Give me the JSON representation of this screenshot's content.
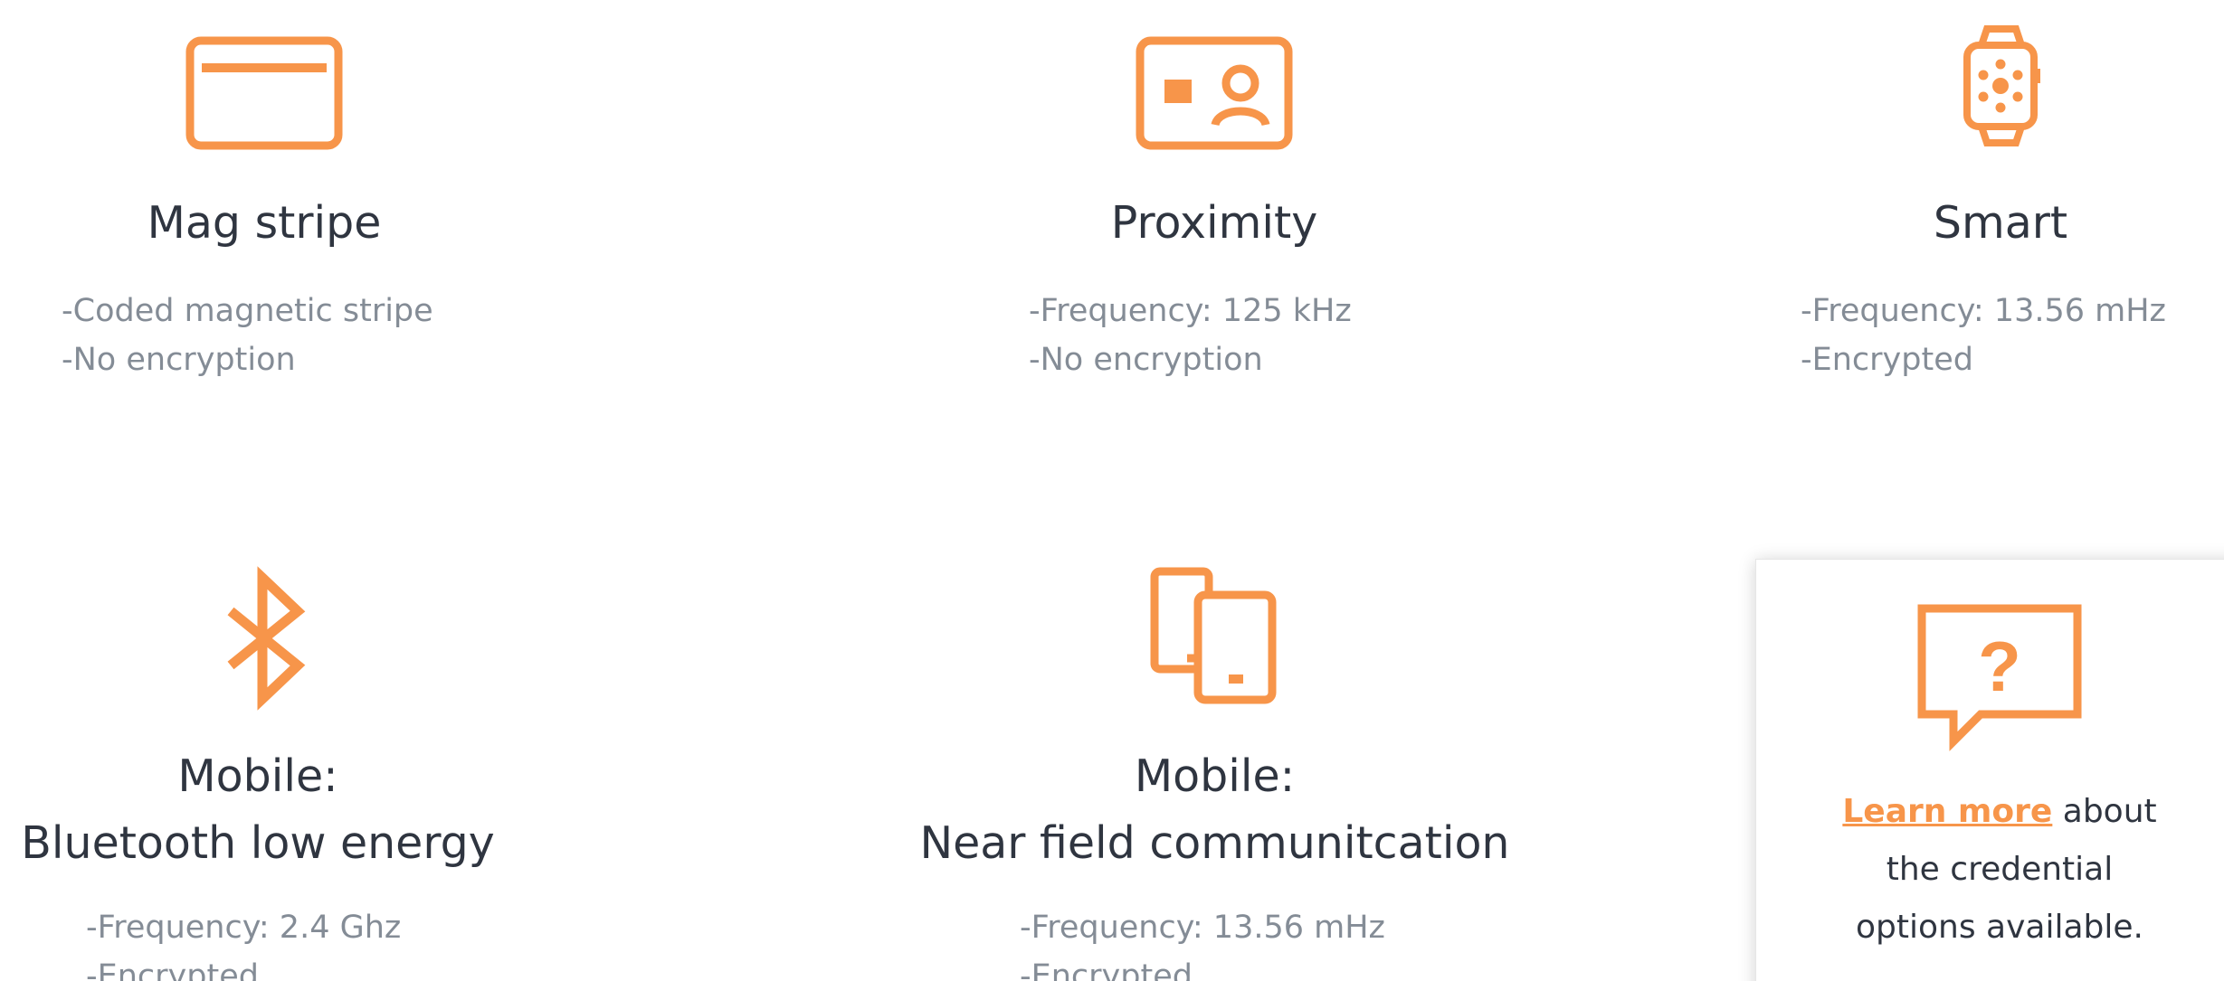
{
  "colors": {
    "accent": "#f7954a",
    "title": "#2f3540",
    "detail": "#848c96",
    "background": "#ffffff"
  },
  "credentials": [
    {
      "icon": "card-icon",
      "title_lines": [
        "Mag stripe"
      ],
      "details": [
        "-Coded magnetic stripe",
        "-No encryption"
      ]
    },
    {
      "icon": "id-card-icon",
      "title_lines": [
        "Proximity"
      ],
      "details": [
        "-Frequency: 125 kHz",
        "-No encryption"
      ]
    },
    {
      "icon": "smartwatch-icon",
      "title_lines": [
        "Smart"
      ],
      "details": [
        "-Frequency: 13.56 mHz",
        "-Encrypted"
      ]
    },
    {
      "icon": "bluetooth-icon",
      "title_lines": [
        "Mobile:",
        "Bluetooth low energy"
      ],
      "details": [
        "-Frequency: 2.4 Ghz",
        "-Encrypted"
      ]
    },
    {
      "icon": "mobile-devices-icon",
      "title_lines": [
        "Mobile:",
        "Near field communitcation"
      ],
      "details": [
        "-Frequency: 13.56 mHz",
        "-Encrypted"
      ]
    }
  ],
  "help": {
    "icon": "question-bubble-icon",
    "link_text": "Learn more",
    "line1_rest": " about",
    "line2": "the credential",
    "line3": "options available."
  }
}
